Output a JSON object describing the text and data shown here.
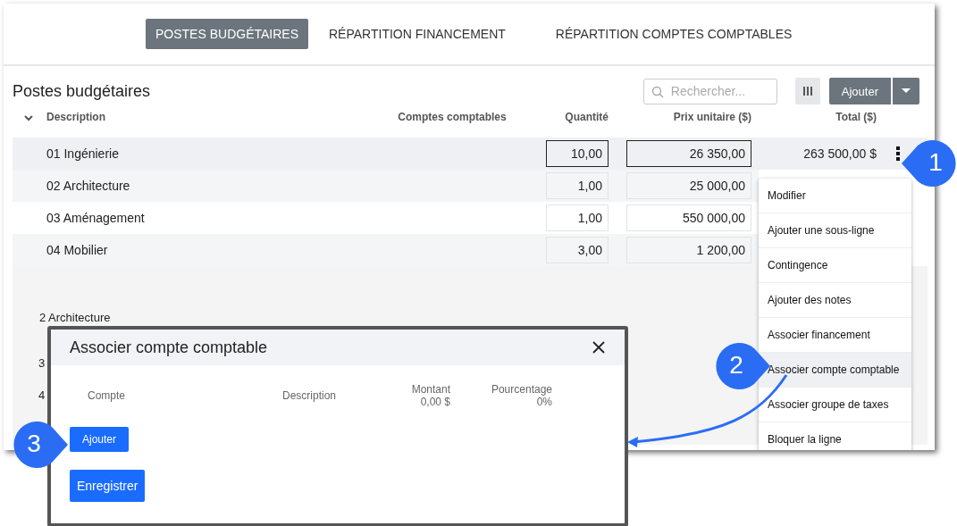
{
  "tabs": [
    {
      "label": "POSTES BUDGÉTAIRES",
      "selected": true
    },
    {
      "label": "RÉPARTITION FINANCEMENT",
      "selected": false
    },
    {
      "label": "RÉPARTITION COMPTES COMPTABLES",
      "selected": false
    }
  ],
  "section_title": "Postes budgétaires",
  "search": {
    "placeholder": "Rechercher..."
  },
  "add_button": "Ajouter",
  "columns": [
    "Description",
    "Comptes comptables",
    "Quantité",
    "Prix unitaire ($)",
    "Total ($)"
  ],
  "rows": [
    {
      "description": "01 Ingénierie",
      "quantity": "10,00",
      "unit_price": "26 350,00",
      "total": "263 500,00 $",
      "selected": true
    },
    {
      "description": "02 Architecture",
      "quantity": "1,00",
      "unit_price": "25 000,00",
      "selected": false
    },
    {
      "description": "03 Aménagement",
      "quantity": "1,00",
      "unit_price": "550 000,00",
      "selected": false
    },
    {
      "description": "04 Mobilier",
      "quantity": "3,00",
      "unit_price": "1 200,00",
      "selected": false
    }
  ],
  "menu": [
    {
      "label": "Modifier",
      "selected": false
    },
    {
      "label": "Ajouter une sous-ligne",
      "selected": false
    },
    {
      "label": "Contingence",
      "selected": false
    },
    {
      "label": "Ajouter des notes",
      "selected": false
    },
    {
      "label": "Associer financement",
      "selected": false
    },
    {
      "label": "Associer compte comptable",
      "selected": true
    },
    {
      "label": "Associer groupe de taxes",
      "selected": false
    },
    {
      "label": "Bloquer la ligne",
      "selected": false
    }
  ],
  "background_fragments": [
    "2 Architecture",
    "3",
    "4"
  ],
  "dialog": {
    "title": "Associer compte comptable",
    "columns": [
      {
        "label": "Compte"
      },
      {
        "label": "Description"
      },
      {
        "label": "Montant",
        "sub": "0,00 $"
      },
      {
        "label": "Pourcentage",
        "sub": "0%"
      }
    ],
    "add_button": "Ajouter",
    "save_button": "Enregistrer"
  },
  "callouts": [
    "1",
    "2",
    "3"
  ]
}
